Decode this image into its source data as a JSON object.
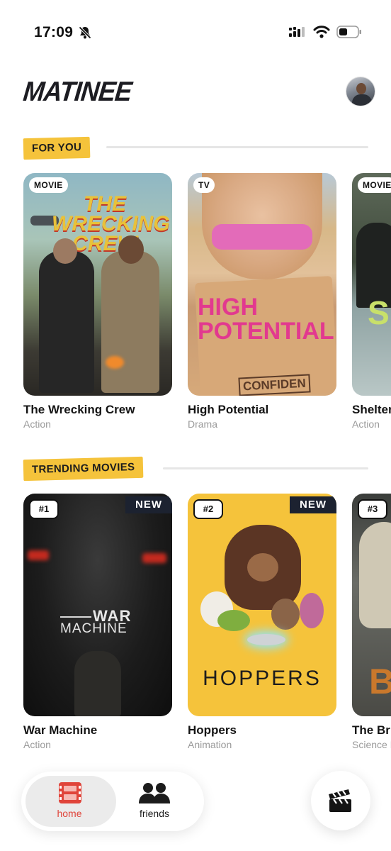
{
  "status_bar": {
    "time": "17:09"
  },
  "app": {
    "logo": "MATINEE"
  },
  "sections": {
    "for_you": {
      "label": "FOR YOU",
      "cards": [
        {
          "badge": "MOVIE",
          "title": "The Wrecking Crew",
          "genre": "Action",
          "poster_text": "THE WRECKING CREW"
        },
        {
          "badge": "TV",
          "title": "High Potential",
          "genre": "Drama",
          "poster_text_1": "HIGH",
          "poster_text_2": "POTENTIAL",
          "poster_text_3": "CONFIDEN"
        },
        {
          "badge": "MOVIE",
          "title": "Shelter",
          "genre": "Action",
          "poster_text": "SH"
        }
      ]
    },
    "trending": {
      "label": "TRENDING MOVIES",
      "cards": [
        {
          "rank": "#1",
          "new": "NEW",
          "title": "War Machine",
          "genre": "Action",
          "poster_text_1": "WAR",
          "poster_text_2": "MACHINE"
        },
        {
          "rank": "#2",
          "new": "NEW",
          "title": "Hoppers",
          "genre": "Animation",
          "poster_text": "HOPPERS"
        },
        {
          "rank": "#3",
          "title": "The Bride!",
          "genre": "Science Fiction",
          "poster_text": "B"
        }
      ]
    }
  },
  "nav": {
    "home_label": "home",
    "friends_label": "friends"
  },
  "colors": {
    "accent": "#f5c33b",
    "home_active": "#e0443a",
    "new_badge": "#1c2230"
  },
  "icons": [
    "bell-slash-icon",
    "signal-icon",
    "wifi-icon",
    "battery-icon",
    "film-icon",
    "friends-icon",
    "clapperboard-icon"
  ]
}
